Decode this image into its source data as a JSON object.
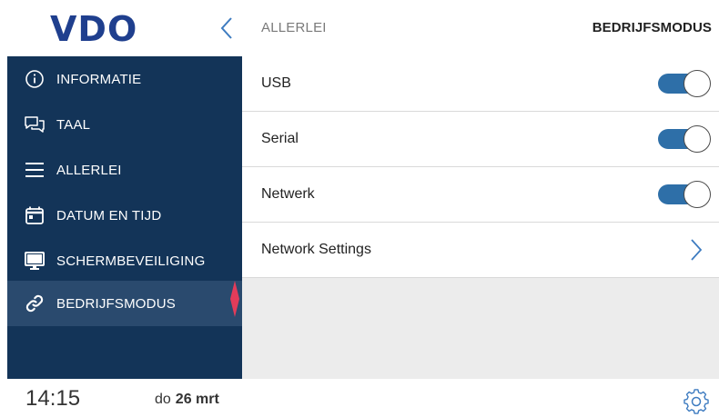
{
  "header": {
    "logo_text": "VDO",
    "title": "ALLERLEI",
    "mode": "BEDRIJFSMODUS"
  },
  "sidebar": {
    "items": [
      {
        "label": "INFORMATIE",
        "icon": "info-icon"
      },
      {
        "label": "TAAL",
        "icon": "chat-icon"
      },
      {
        "label": "ALLERLEI",
        "icon": "menu-icon"
      },
      {
        "label": "DATUM EN TIJD",
        "icon": "calendar-icon"
      },
      {
        "label": "SCHERMBEVEILIGING",
        "icon": "monitor-icon"
      },
      {
        "label": "BEDRIJFSMODUS",
        "icon": "link-icon",
        "active": true
      }
    ]
  },
  "settings": {
    "rows": [
      {
        "label": "USB",
        "toggle": true
      },
      {
        "label": "Serial",
        "toggle": true
      },
      {
        "label": "Netwerk",
        "toggle": true
      },
      {
        "label": "Network Settings",
        "chevron": true
      }
    ]
  },
  "footer": {
    "time": "14:15",
    "day": "do",
    "date": "26 mrt"
  },
  "colors": {
    "sidebar_bg": "#133458",
    "sidebar_active": "#2a4a6e",
    "accent": "#2e6fa8",
    "marker": "#e23c5a",
    "logo": "#1f3f8e"
  }
}
